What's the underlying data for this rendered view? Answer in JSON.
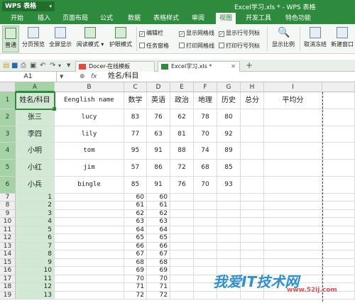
{
  "app": {
    "name": "WPS 表格",
    "doc_title": "Excel学习.xls * - WPS 表格"
  },
  "menu": [
    {
      "label": "开始",
      "active": false
    },
    {
      "label": "插入",
      "active": false
    },
    {
      "label": "页面布局",
      "active": false
    },
    {
      "label": "公式",
      "active": false
    },
    {
      "label": "数据",
      "active": false
    },
    {
      "label": "表格样式",
      "active": false
    },
    {
      "label": "审阅",
      "active": false
    },
    {
      "label": "视图",
      "active": true
    },
    {
      "label": "开发工具",
      "active": false
    },
    {
      "label": "特色功能",
      "active": false
    }
  ],
  "ribbon": {
    "normal": "普通",
    "page_break_preview": "分页预览",
    "full_screen": "全屏显示",
    "reading_mode": "阅读模式",
    "eye_mode": "护眼模式",
    "edit_bar": "编辑栏",
    "task_pane": "任务窗格",
    "show_gridlines": "显示网格线",
    "print_gridlines": "打印网格线",
    "show_row_col_headers": "显示行号列标",
    "print_row_col_headers": "打印行号列标",
    "zoom": "显示比例",
    "unfreeze": "取消冻结",
    "new_window": "新建窗口"
  },
  "tabs": [
    {
      "label": "Docer-在线模板",
      "active": false
    },
    {
      "label": "Excel学习.xls *",
      "active": true
    }
  ],
  "formula_bar": {
    "name_box": "A1",
    "fx": "fx",
    "content": "姓名/科目"
  },
  "columns": [
    "A",
    "B",
    "C",
    "D",
    "E",
    "F",
    "G",
    "H",
    "I"
  ],
  "rows": [
    "1",
    "2",
    "3",
    "4",
    "5",
    "6",
    "7",
    "8",
    "9",
    "10",
    "11",
    "12",
    "13",
    "14",
    "15",
    "16",
    "17",
    "18",
    "19"
  ],
  "table": {
    "header": [
      "姓名/科目",
      "Eenglish name",
      "数学",
      "英语",
      "政治",
      "地理",
      "历史",
      "总分",
      "平均分"
    ],
    "rows": [
      [
        "张三",
        "lucy",
        "83",
        "76",
        "62",
        "78",
        "80",
        "",
        ""
      ],
      [
        "李四",
        "lily",
        "77",
        "63",
        "81",
        "70",
        "92",
        "",
        ""
      ],
      [
        "小明",
        "tom",
        "95",
        "91",
        "88",
        "74",
        "89",
        "",
        ""
      ],
      [
        "小红",
        "jim",
        "57",
        "86",
        "72",
        "68",
        "85",
        "",
        ""
      ],
      [
        "小兵",
        "bingle",
        "85",
        "91",
        "76",
        "70",
        "93",
        "",
        ""
      ]
    ]
  },
  "series": {
    "a": [
      "1",
      "2",
      "3",
      "4",
      "5",
      "6",
      "7",
      "8",
      "9",
      "10",
      "11",
      "12",
      "13"
    ],
    "c": [
      "60",
      "61",
      "62",
      "63",
      "64",
      "65",
      "66",
      "67",
      "68",
      "69",
      "70",
      "71",
      "72"
    ],
    "d": [
      "60",
      "61",
      "62",
      "63",
      "64",
      "65",
      "66",
      "67",
      "68",
      "69",
      "70",
      "71",
      "72"
    ]
  },
  "watermark": {
    "main": "我爱IT技术网",
    "url": "www.52ij.com"
  }
}
